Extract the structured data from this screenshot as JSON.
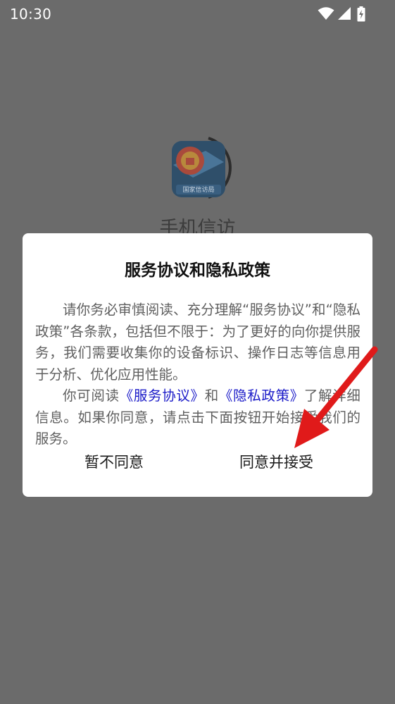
{
  "status_bar": {
    "time": "10:30",
    "icons": [
      "wifi-icon",
      "signal-icon",
      "battery-charging-icon"
    ]
  },
  "app": {
    "name": "手机信访",
    "logo_text": "国家信访局"
  },
  "dialog": {
    "title": "服务协议和隐私政策",
    "paragraph1": "请你务必审慎阅读、充分理解“服务协议”和“隐私政策”各条款，包括但不限于：为了更好的向你提供服务，我们需要收集你的设备标识、操作日志等信息用于分析、优化应用性能。",
    "paragraph2": {
      "prefix": "你可阅读",
      "link_service": "《服务协议》",
      "connector": "和",
      "link_privacy": "《隐私政策》",
      "suffix": "了解详细信息。如果你同意，请点击下面按钮开始接受我们的服务。"
    },
    "buttons": {
      "disagree": "暂不同意",
      "agree": "同意并接受"
    }
  },
  "colors": {
    "overlay": "#6b6b6b",
    "link": "#1a1ac8",
    "annotation_arrow": "#e01a1a"
  }
}
